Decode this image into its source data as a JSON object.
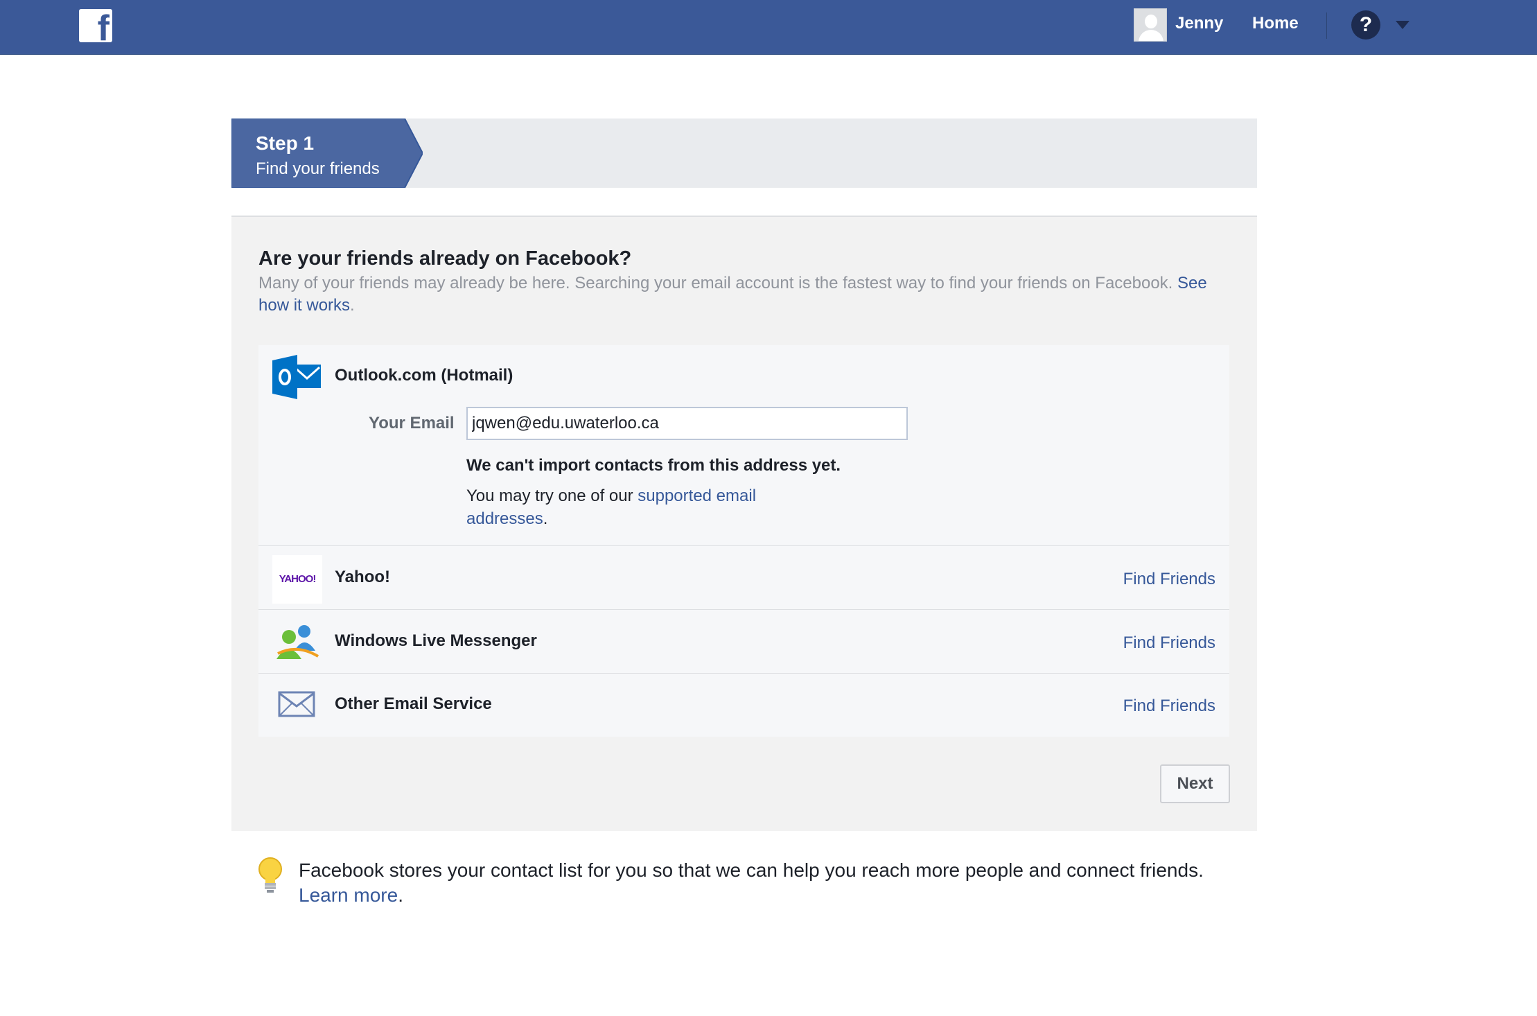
{
  "header": {
    "logo_letter": "f",
    "user_name": "Jenny",
    "home_label": "Home",
    "help_symbol": "?",
    "brand_color": "#3b5998"
  },
  "stepper": {
    "step_label": "Step 1",
    "step_title": "Find your friends",
    "active_color": "#4b67a1"
  },
  "main": {
    "heading": "Are your friends already on Facebook?",
    "description": "Many of your friends may already be here. Searching your email account is the fastest way to find your friends on Facebook.",
    "description_link": "See how it works",
    "description_end": "."
  },
  "providers": [
    {
      "name": "Outlook.com (Hotmail)",
      "icon": "outlook-icon",
      "email_label": "Your Email",
      "email_value": "jqwen@edu.uwaterloo.ca",
      "error_title": "We can't import contacts from this address yet.",
      "error_text": "You may try one of our",
      "error_link": "supported email addresses",
      "error_end": "."
    },
    {
      "name": "Yahoo!",
      "icon": "yahoo-logo",
      "logo_text": "YAHOO!",
      "action": "Find Friends"
    },
    {
      "name": "Windows Live Messenger",
      "icon": "messenger-icon",
      "action": "Find Friends"
    },
    {
      "name": "Other Email Service",
      "icon": "mail-icon",
      "action": "Find Friends"
    }
  ],
  "actions": {
    "next_label": "Next"
  },
  "footer": {
    "tip_text": "Facebook stores your contact list for you so that we can help you reach more people and connect friends.",
    "tip_link": "Learn more",
    "tip_end": ".",
    "icon": "lightbulb-icon"
  }
}
